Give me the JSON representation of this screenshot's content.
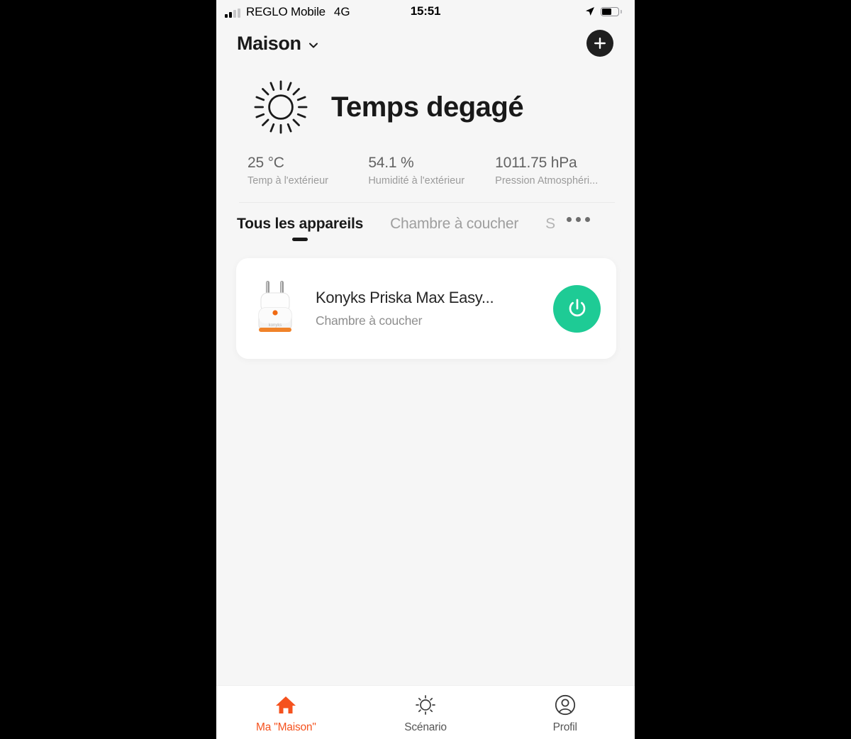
{
  "statusbar": {
    "carrier": "REGLO Mobile",
    "network": "4G",
    "time": "15:51",
    "signal_icon": "signal-bars-icon",
    "location_icon": "location-arrow-icon",
    "battery_icon": "battery-icon",
    "battery_level": 60
  },
  "header": {
    "home_name": "Maison",
    "chevron_icon": "chevron-down-icon",
    "add_label": "+",
    "add_icon": "plus-icon"
  },
  "weather": {
    "icon": "sun-icon",
    "condition": "Temps degagé",
    "stats": [
      {
        "value": "25 °C",
        "label": "Temp à l'extérieur"
      },
      {
        "value": "54.1 %",
        "label": "Humidité à l'extérieur"
      },
      {
        "value": "1011.75 hPa",
        "label": "Pression Atmosphéri..."
      }
    ]
  },
  "tabs": {
    "items": [
      {
        "label": "Tous les appareils",
        "active": true
      },
      {
        "label": "Chambre à coucher",
        "active": false
      },
      {
        "label": "S",
        "active": false,
        "clipped": true
      }
    ],
    "more_icon": "more-dots-icon"
  },
  "devices": [
    {
      "icon": "smart-plug-icon",
      "name": "Konyks Priska Max Easy...",
      "room": "Chambre à coucher",
      "power_icon": "power-icon",
      "power_state": "on",
      "power_color": "#1ecb95"
    }
  ],
  "bottom_nav": {
    "items": [
      {
        "label": "Ma \"Maison\"",
        "icon": "home-icon",
        "active": true
      },
      {
        "label": "Scénario",
        "icon": "sun-outline-icon",
        "active": false
      },
      {
        "label": "Profil",
        "icon": "person-circle-icon",
        "active": false
      }
    ],
    "active_color": "#f5521e"
  }
}
